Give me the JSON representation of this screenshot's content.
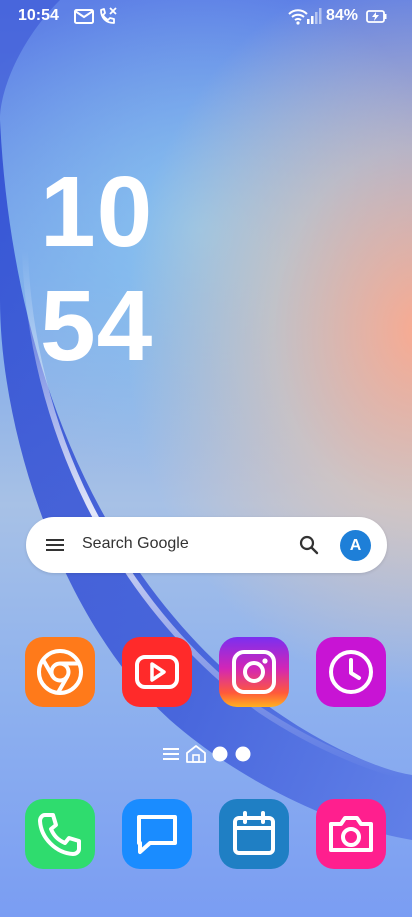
{
  "status_bar": {
    "time": "10:54",
    "battery_percent": "84%",
    "icons": [
      "email-icon",
      "missed-call-icon",
      "wifi-icon",
      "signal-icon",
      "battery-charging-icon"
    ]
  },
  "clock": {
    "hours": "10",
    "minutes": "54"
  },
  "search_widget": {
    "placeholder": "Search Google",
    "avatar_letter": "A",
    "icons": [
      "menu-icon",
      "search-icon"
    ]
  },
  "home_apps": [
    {
      "icon": "chrome-icon",
      "color": "#ff7a1a"
    },
    {
      "icon": "youtube-icon",
      "color": "#ff2a2a"
    },
    {
      "icon": "instagram-icon",
      "color": "#c12dd1"
    },
    {
      "icon": "clock-icon",
      "color": "#c814d4"
    }
  ],
  "dock_apps": [
    {
      "icon": "phone-icon",
      "color": "#2fdc6e"
    },
    {
      "icon": "messages-icon",
      "color": "#1a8cff"
    },
    {
      "icon": "calendar-icon",
      "color": "#1f7fc4"
    },
    {
      "icon": "camera-icon",
      "color": "#ff1f8e"
    }
  ],
  "page_indicator": {
    "icons": [
      "list-icon",
      "home-icon"
    ],
    "dots": 2
  },
  "colors": {
    "wallpaper_top": "#5d7fe6",
    "wallpaper_warm": "#f6a888",
    "swoosh_blue": "#2b46c8"
  }
}
